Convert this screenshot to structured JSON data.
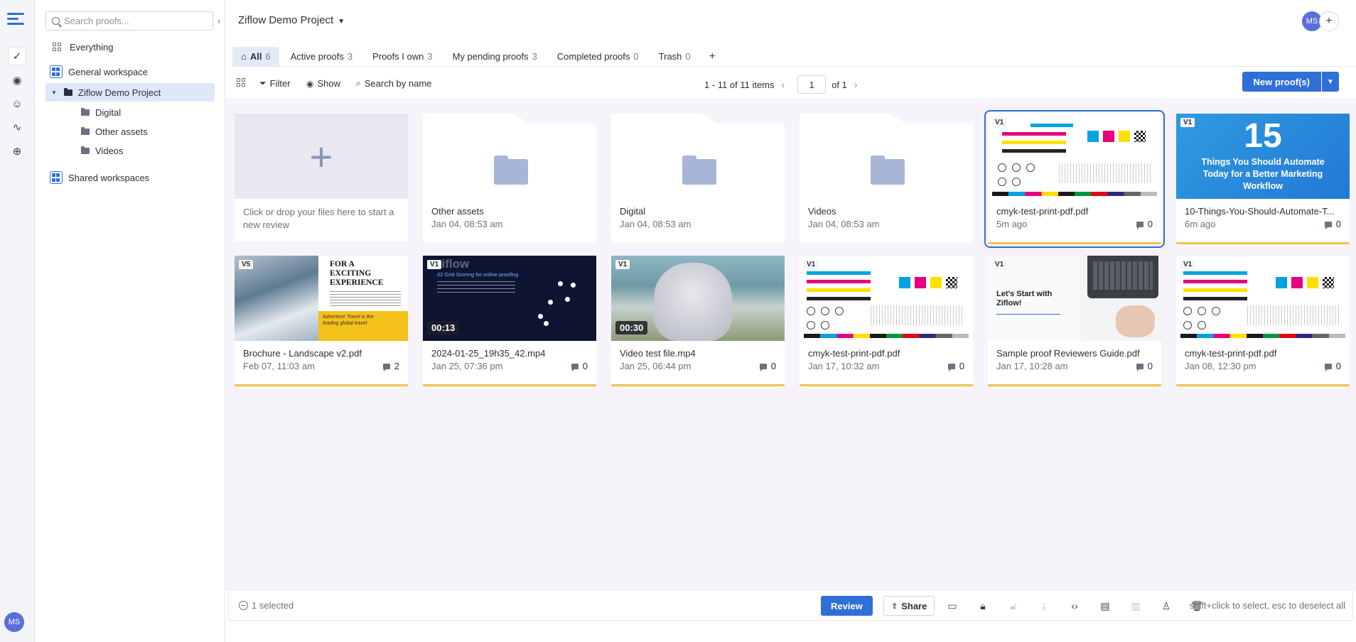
{
  "app": {
    "user_initials": "MS"
  },
  "sidebar": {
    "search_placeholder": "Search proofs...",
    "items": [
      {
        "label": "Everything"
      },
      {
        "label": "General workspace"
      },
      {
        "label": "Ziflow Demo Project"
      },
      {
        "label": "Digital"
      },
      {
        "label": "Other assets"
      },
      {
        "label": "Videos"
      },
      {
        "label": "Shared workspaces"
      }
    ]
  },
  "header": {
    "project_title": "Ziflow Demo Project",
    "add_label": "+"
  },
  "tabs": [
    {
      "label": "All",
      "count": "6"
    },
    {
      "label": "Active proofs",
      "count": "3"
    },
    {
      "label": "Proofs I own",
      "count": "3"
    },
    {
      "label": "My pending proofs",
      "count": "3"
    },
    {
      "label": "Completed proofs",
      "count": "0"
    },
    {
      "label": "Trash",
      "count": "0"
    }
  ],
  "toolbar": {
    "filter_label": "Filter",
    "show_label": "Show",
    "search_label": "Search by name",
    "items_range": "1 - 11 of 11 items",
    "page_current": "1",
    "page_total": "of 1",
    "new_proof_label": "New proof(s)"
  },
  "grid": {
    "add_hint": "Click or drop your files here to start a new review",
    "folders": [
      {
        "name": "Other assets",
        "date": "Jan 04, 08:53 am"
      },
      {
        "name": "Digital",
        "date": "Jan 04, 08:53 am"
      },
      {
        "name": "Videos",
        "date": "Jan 04, 08:53 am"
      }
    ],
    "files": [
      {
        "name": "cmyk-test-print-pdf.pdf",
        "date": "5m ago",
        "comments": "0",
        "version": "V1"
      },
      {
        "name": "10-Things-You-Should-Automate-T...",
        "date": "6m ago",
        "comments": "0",
        "version": "V1",
        "promo_num": "15",
        "promo_text": "Things You Should Automate Today for a Better Marketing Workflow"
      },
      {
        "name": "Brochure - Landscape v2.pdf",
        "date": "Feb 07, 11:03 am",
        "comments": "2",
        "version": "V5",
        "headline": "FOR A EXCITING EXPERIENCE",
        "tagline": "Adventure Travel is the leading global travel"
      },
      {
        "name": "2024-01-25_19h35_42.mp4",
        "date": "Jan 25, 07:36 pm",
        "comments": "0",
        "version": "V1",
        "duration": "00:13",
        "slide_title": "ziflow",
        "slide_sub": "02 Grid Scoring for online proofing"
      },
      {
        "name": "Video test file.mp4",
        "date": "Jan 25, 06:44 pm",
        "comments": "0",
        "version": "V1",
        "duration": "00:30"
      },
      {
        "name": "cmyk-test-print-pdf.pdf",
        "date": "Jan 17, 10:32 am",
        "comments": "0",
        "version": "V1"
      },
      {
        "name": "Sample proof Reviewers Guide.pdf",
        "date": "Jan 17, 10:28 am",
        "comments": "0",
        "version": "V1",
        "guide_title": "Let's Start with Ziflow!"
      },
      {
        "name": "cmyk-test-print-pdf.pdf",
        "date": "Jan 08, 12:30 pm",
        "comments": "0",
        "version": "V1"
      }
    ]
  },
  "bottom": {
    "selected_text": "1 selected",
    "review_label": "Review",
    "share_label": "Share",
    "hint": "shift+click to select, esc to deselect all"
  },
  "colors": {
    "accent": "#2e6fd8",
    "file_underline": "#f0c24e",
    "content_bg": "#f6f4fa"
  }
}
